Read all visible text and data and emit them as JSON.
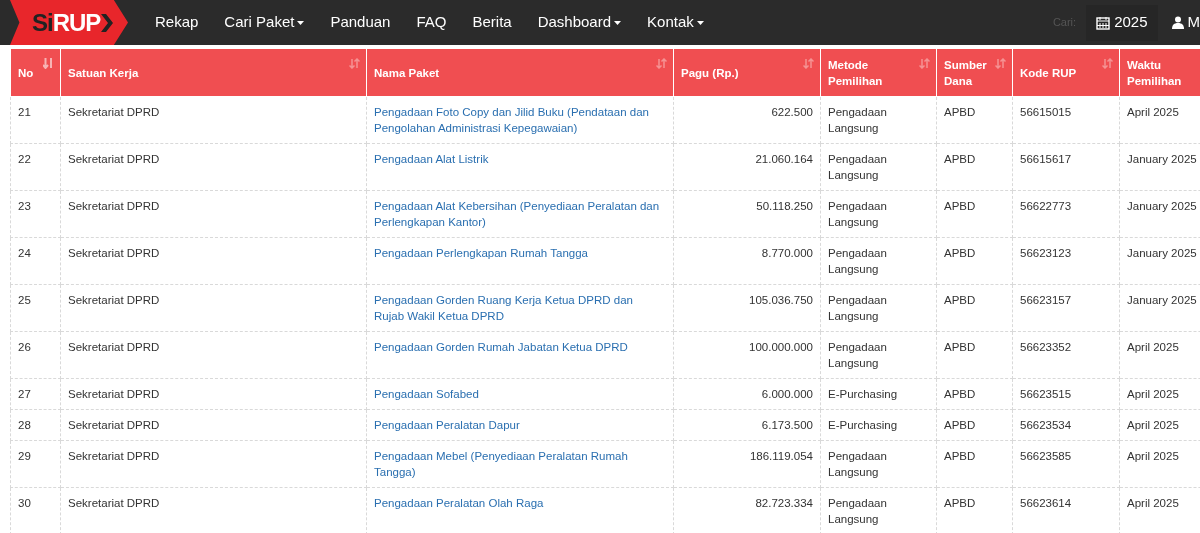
{
  "navbar": {
    "logo": {
      "prefix": "Si",
      "main": "RUP"
    },
    "menu": [
      {
        "label": "Rekap",
        "dropdown": false
      },
      {
        "label": "Cari Paket",
        "dropdown": true
      },
      {
        "label": "Panduan",
        "dropdown": false
      },
      {
        "label": "FAQ",
        "dropdown": false
      },
      {
        "label": "Berita",
        "dropdown": false
      },
      {
        "label": "Dashboard",
        "dropdown": true
      },
      {
        "label": "Kontak",
        "dropdown": true
      }
    ],
    "search_label": "Cari:",
    "year": "2025",
    "user": "M"
  },
  "table": {
    "columns": [
      {
        "label": "No",
        "sorted": true
      },
      {
        "label": "Satuan Kerja",
        "sorted": false
      },
      {
        "label": "Nama Paket",
        "sorted": false
      },
      {
        "label": "Pagu (Rp.)",
        "sorted": false
      },
      {
        "label": "Metode Pemilihan",
        "sorted": false
      },
      {
        "label": "Sumber Dana",
        "sorted": false
      },
      {
        "label": "Kode RUP",
        "sorted": false
      },
      {
        "label": "Waktu Pemilihan"
      }
    ],
    "rows": [
      [
        "21",
        "Sekretariat DPRD",
        "Pengadaan Foto Copy dan Jilid Buku (Pendataan dan Pengolahan Administrasi Kepegawaian)",
        "622.500",
        "Pengadaan Langsung",
        "APBD",
        "56615015",
        "April 2025"
      ],
      [
        "22",
        "Sekretariat DPRD",
        "Pengadaan Alat Listrik",
        "21.060.164",
        "Pengadaan Langsung",
        "APBD",
        "56615617",
        "January 2025"
      ],
      [
        "23",
        "Sekretariat DPRD",
        "Pengadaan Alat Kebersihan (Penyediaan Peralatan dan Perlengkapan Kantor)",
        "50.118.250",
        "Pengadaan Langsung",
        "APBD",
        "56622773",
        "January 2025"
      ],
      [
        "24",
        "Sekretariat DPRD",
        "Pengadaan Perlengkapan Rumah Tangga",
        "8.770.000",
        "Pengadaan Langsung",
        "APBD",
        "56623123",
        "January 2025"
      ],
      [
        "25",
        "Sekretariat DPRD",
        "Pengadaan Gorden Ruang Kerja Ketua DPRD dan Rujab Wakil Ketua DPRD",
        "105.036.750",
        "Pengadaan Langsung",
        "APBD",
        "56623157",
        "January 2025"
      ],
      [
        "26",
        "Sekretariat DPRD",
        "Pengadaan Gorden Rumah Jabatan Ketua DPRD",
        "100.000.000",
        "Pengadaan Langsung",
        "APBD",
        "56623352",
        "April 2025"
      ],
      [
        "27",
        "Sekretariat DPRD",
        "Pengadaan Sofabed",
        "6.000.000",
        "E-Purchasing",
        "APBD",
        "56623515",
        "April 2025"
      ],
      [
        "28",
        "Sekretariat DPRD",
        "Pengadaan Peralatan Dapur",
        "6.173.500",
        "E-Purchasing",
        "APBD",
        "56623534",
        "April 2025"
      ],
      [
        "29",
        "Sekretariat DPRD",
        "Pengadaan Mebel (Penyediaan Peralatan Rumah Tangga)",
        "186.119.054",
        "Pengadaan Langsung",
        "APBD",
        "56623585",
        "April 2025"
      ],
      [
        "30",
        "Sekretariat DPRD",
        "Pengadaan Peralatan Olah Raga",
        "82.723.334",
        "Pengadaan Langsung",
        "APBD",
        "56623614",
        "April 2025"
      ]
    ]
  }
}
